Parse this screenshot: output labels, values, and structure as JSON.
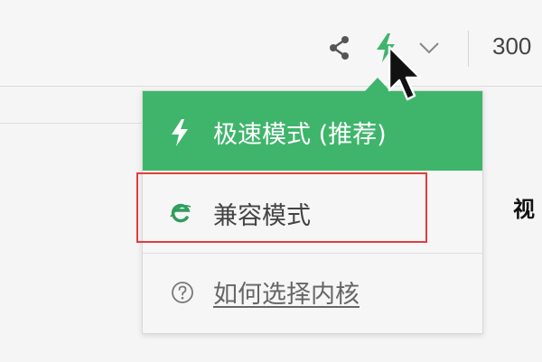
{
  "toolbar": {
    "zoom_text": "300",
    "icons": {
      "share": "share-icon",
      "mode": "lightning-bolt-icon",
      "dropdown": "chevron-down-icon"
    }
  },
  "page": {
    "side_label": "视"
  },
  "dropdown": {
    "items": [
      {
        "label": "极速模式 (推荐)",
        "icon": "lightning-bolt-icon",
        "selected": true
      },
      {
        "label": "兼容模式",
        "icon": "ie-icon"
      },
      {
        "label": "如何选择内核",
        "icon": "question-circle-icon"
      }
    ]
  },
  "colors": {
    "accent_green": "#3fb56b",
    "highlight_red": "#e63b3b",
    "ie_green": "#2e9e5c"
  }
}
